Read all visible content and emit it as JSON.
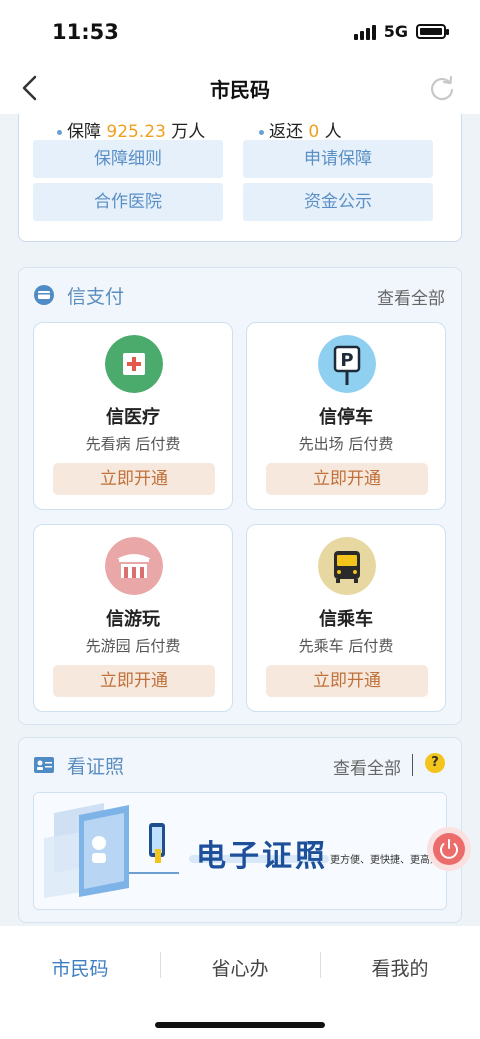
{
  "status": {
    "time": "11:53",
    "network": "5G"
  },
  "nav": {
    "title": "市民码"
  },
  "stats": {
    "item1_label": "保障",
    "item1_value": "925.23",
    "item1_unit": "万人",
    "item2_label": "返还",
    "item2_value": "0",
    "item2_unit": "人"
  },
  "guarantee_buttons": [
    "保障细则",
    "申请保障",
    "合作医院",
    "资金公示"
  ],
  "pay_section": {
    "title": "信支付",
    "more": "查看全部",
    "services": [
      {
        "name": "信医疗",
        "desc": "先看病 后付费",
        "action": "立即开通",
        "icon": "medical-icon",
        "color": "#4aab6d"
      },
      {
        "name": "信停车",
        "desc": "先出场 后付费",
        "action": "立即开通",
        "icon": "parking-icon",
        "color": "#8fd0f0"
      },
      {
        "name": "信游玩",
        "desc": "先游园 后付费",
        "action": "立即开通",
        "icon": "park-gate-icon",
        "color": "#e9a7a7"
      },
      {
        "name": "信乘车",
        "desc": "先乘车 后付费",
        "action": "立即开通",
        "icon": "bus-icon",
        "color": "#e7d7a0"
      }
    ]
  },
  "cert_section": {
    "title": "看证照",
    "more": "查看全部",
    "help": "?",
    "banner_title": "电子证照",
    "banner_subtitle": "更方便、更快捷、更高效"
  },
  "tabs": [
    "市民码",
    "省心办",
    "看我的"
  ],
  "colors": {
    "accent": "#3f7fc1",
    "orange": "#f0a020",
    "button_text": "#c0703a"
  }
}
